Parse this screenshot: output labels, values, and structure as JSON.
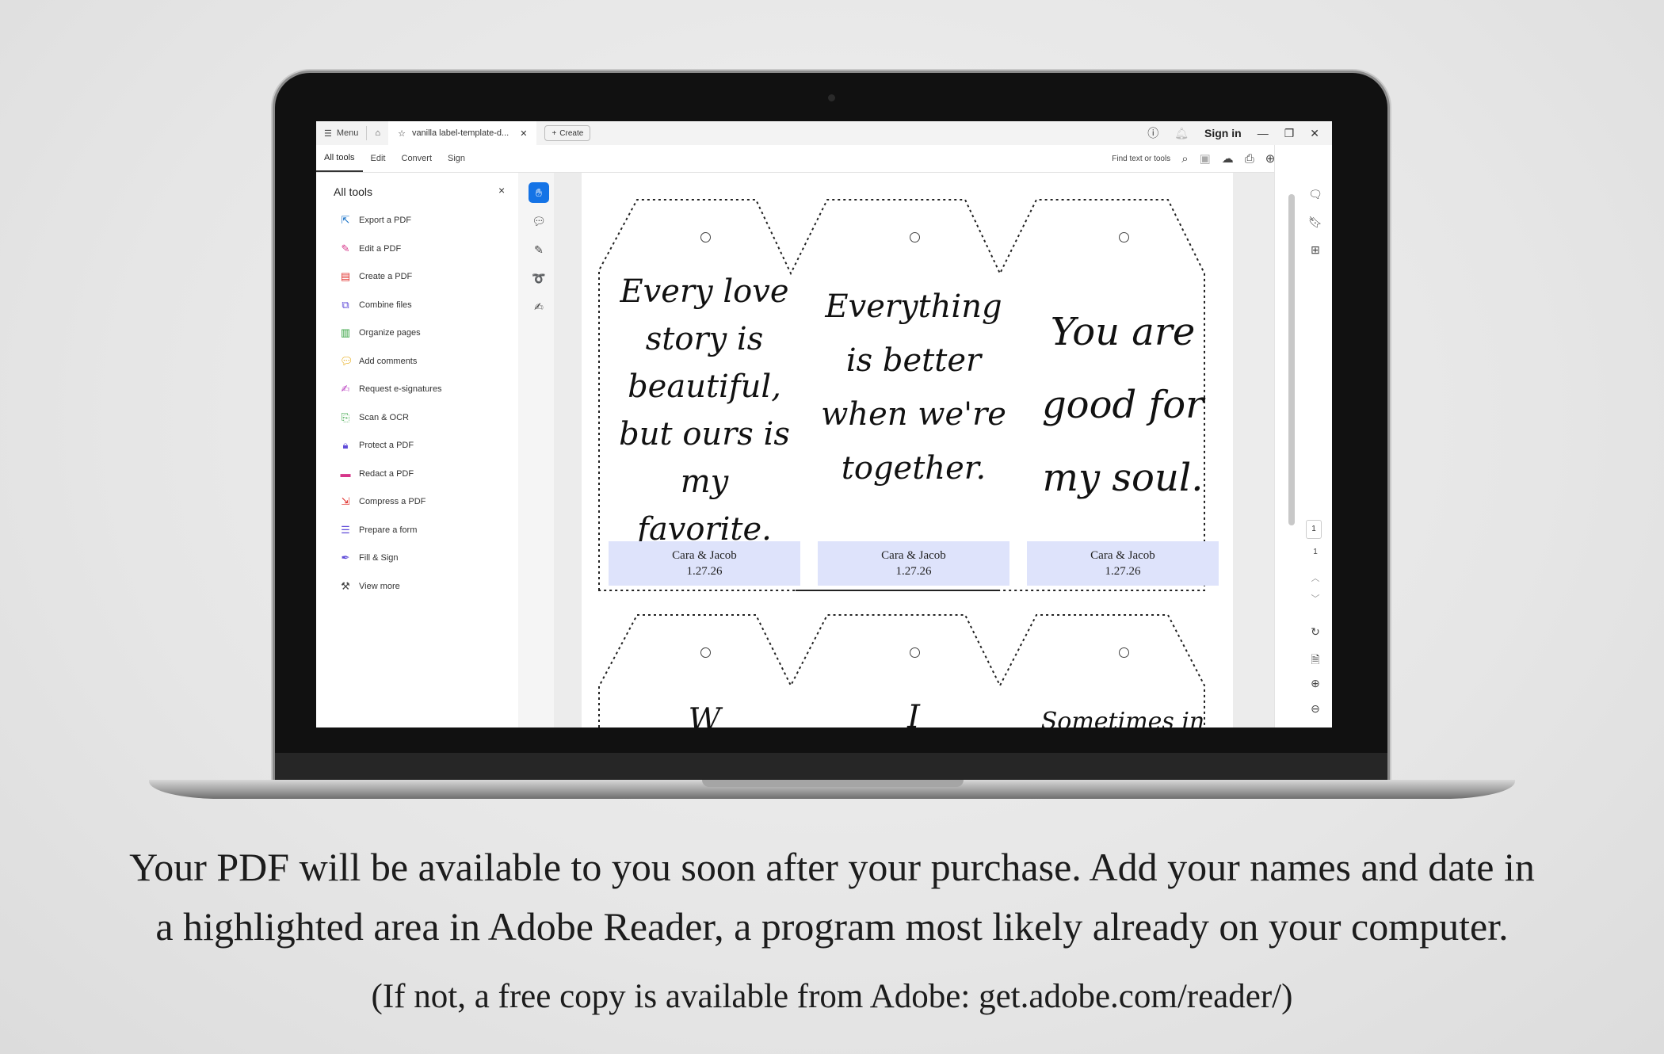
{
  "app": {
    "menu_label": "Menu",
    "tab_title": "vanilla label-template-d...",
    "create_label": "Create",
    "sign_in": "Sign in",
    "window_controls": [
      "minimize-icon",
      "restore-icon",
      "close-icon"
    ]
  },
  "menubar": {
    "items": [
      "All tools",
      "Edit",
      "Convert",
      "Sign"
    ],
    "active": "All tools",
    "find_placeholder": "Find text or tools"
  },
  "left_panel": {
    "title": "All tools",
    "tools": [
      {
        "label": "Export a PDF",
        "icon": "export-pdf-icon",
        "color": "#1a73c8"
      },
      {
        "label": "Edit a PDF",
        "icon": "edit-pdf-icon",
        "color": "#d6368a"
      },
      {
        "label": "Create a PDF",
        "icon": "create-pdf-icon",
        "color": "#e0312d"
      },
      {
        "label": "Combine files",
        "icon": "combine-files-icon",
        "color": "#5f4bd8"
      },
      {
        "label": "Organize pages",
        "icon": "organize-pages-icon",
        "color": "#2e9e3a"
      },
      {
        "label": "Add comments",
        "icon": "add-comments-icon",
        "color": "#e5a400"
      },
      {
        "label": "Request e-signatures",
        "icon": "request-esign-icon",
        "color": "#b93ec0"
      },
      {
        "label": "Scan & OCR",
        "icon": "scan-ocr-icon",
        "color": "#2e9e3a"
      },
      {
        "label": "Protect a PDF",
        "icon": "protect-pdf-icon",
        "color": "#5f4bd8"
      },
      {
        "label": "Redact a PDF",
        "icon": "redact-pdf-icon",
        "color": "#d6368a"
      },
      {
        "label": "Compress a PDF",
        "icon": "compress-pdf-icon",
        "color": "#e0312d"
      },
      {
        "label": "Prepare a form",
        "icon": "prepare-form-icon",
        "color": "#5f4bd8"
      },
      {
        "label": "Fill & Sign",
        "icon": "fill-sign-icon",
        "color": "#5f4bd8"
      },
      {
        "label": "View more",
        "icon": "view-more-icon",
        "color": "#444444"
      }
    ]
  },
  "document": {
    "labels": [
      {
        "quote": [
          "Every love",
          "story is",
          "beautiful,",
          "but ours is",
          "my favorite."
        ],
        "names": "Cara & Jacob",
        "date": "1.27.26"
      },
      {
        "quote": [
          "Everything",
          "is better",
          "when we're",
          "together."
        ],
        "names": "Cara & Jacob",
        "date": "1.27.26"
      },
      {
        "quote": [
          "You are",
          "good for",
          "my soul."
        ],
        "names": "Cara & Jacob",
        "date": "1.27.26"
      }
    ],
    "second_row_fragments": [
      "W",
      "I",
      "Sometimes in"
    ]
  },
  "page_nav": {
    "current_page": "1",
    "total_pages": "1"
  },
  "colors": {
    "accent": "#1473e6",
    "highlight": "#dee3fb"
  },
  "captions": {
    "line1": "Your PDF will be available to you soon after your purchase. Add your names and date in",
    "line2": "a highlighted area in Adobe Reader, a program most likely already on your computer.",
    "line3": "(If not, a free copy is available from Adobe: get.adobe.com/reader/)"
  }
}
